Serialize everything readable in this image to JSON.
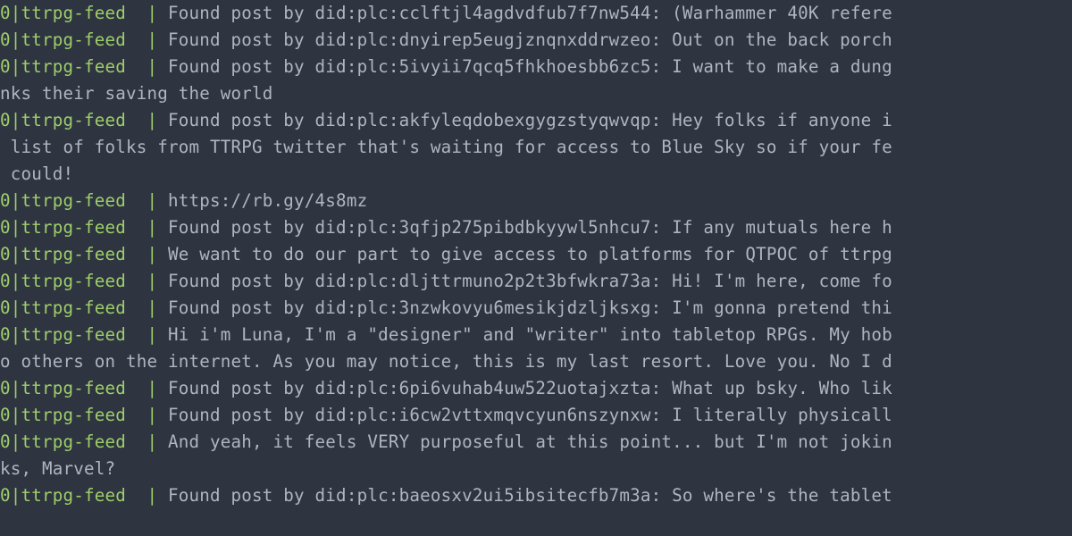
{
  "colors": {
    "background": "#2e3440",
    "prefix": "#9ece6a",
    "text": "#aeb6c2"
  },
  "process": {
    "id": "0",
    "name": "ttrpg-feed"
  },
  "prefix": "0|ttrpg-feed  | ",
  "lines": [
    {
      "prefixed": true,
      "text": "Found post by did:plc:cclftjl4agdvdfub7f7nw544: (Warhammer 40K refere"
    },
    {
      "prefixed": true,
      "text": "Found post by did:plc:dnyirep5eugjznqnxddrwzeo: Out on the back porch"
    },
    {
      "prefixed": true,
      "text": "Found post by did:plc:5ivyii7qcq5fhkhoesbb6zc5: I want to make a dung"
    },
    {
      "prefixed": false,
      "text": "nks their saving the world"
    },
    {
      "prefixed": true,
      "text": "Found post by did:plc:akfyleqdobexgygzstyqwvqp: Hey folks if anyone i"
    },
    {
      "prefixed": false,
      "text": " list of folks from TTRPG twitter that's waiting for access to Blue Sky so if your fe"
    },
    {
      "prefixed": false,
      "text": " could!"
    },
    {
      "prefixed": true,
      "text": "https://rb.gy/4s8mz"
    },
    {
      "prefixed": true,
      "text": "Found post by did:plc:3qfjp275pibdbkyywl5nhcu7: If any mutuals here h"
    },
    {
      "prefixed": true,
      "text": "We want to do our part to give access to platforms for QTPOC of ttrpg"
    },
    {
      "prefixed": true,
      "text": "Found post by did:plc:dljttrmuno2p2t3bfwkra73a: Hi! I'm here, come fo"
    },
    {
      "prefixed": true,
      "text": "Found post by did:plc:3nzwkovyu6mesikjdzljksxg: I'm gonna pretend thi"
    },
    {
      "prefixed": true,
      "text": "Hi i'm Luna, I'm a \"designer\" and \"writer\" into tabletop RPGs. My hob"
    },
    {
      "prefixed": false,
      "text": "o others on the internet. As you may notice, this is my last resort. Love you. No I d"
    },
    {
      "prefixed": true,
      "text": "Found post by did:plc:6pi6vuhab4uw522uotajxzta: What up bsky. Who lik"
    },
    {
      "prefixed": true,
      "text": "Found post by did:plc:i6cw2vttxmqvcyun6nszynxw: I literally physicall"
    },
    {
      "prefixed": true,
      "text": "And yeah, it feels VERY purposeful at this point... but I'm not jokin"
    },
    {
      "prefixed": false,
      "text": "ks, Marvel?"
    },
    {
      "prefixed": false,
      "text": ""
    },
    {
      "prefixed": true,
      "text": "Found post by did:plc:baeosxv2ui5ibsitecfb7m3a: So where's the tablet"
    }
  ]
}
